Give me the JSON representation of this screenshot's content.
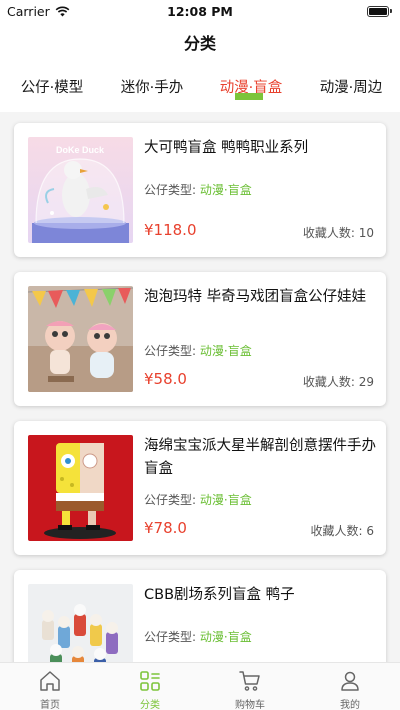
{
  "status_bar": {
    "carrier": "Carrier",
    "time": "12:08 PM"
  },
  "nav": {
    "title": "分类"
  },
  "tabs": [
    {
      "label": "公仔·模型"
    },
    {
      "label": "迷你·手办"
    },
    {
      "label": "动漫·盲盒",
      "active": true
    },
    {
      "label": "动漫·周边"
    }
  ],
  "products": [
    {
      "title": "大可鸭盲盒 鸭鸭职业系列",
      "type_label": "公仔类型:",
      "type_value": "动漫·盲盒",
      "price": "¥118.0",
      "fav_label": "收藏人数:",
      "fav_count": "10",
      "image_text": "DoKe Duck"
    },
    {
      "title": "泡泡玛特 毕奇马戏团盲盒公仔娃娃",
      "type_label": "公仔类型:",
      "type_value": "动漫·盲盒",
      "price": "¥58.0",
      "fav_label": "收藏人数:",
      "fav_count": "29"
    },
    {
      "title": "海绵宝宝派大星半解剖创意摆件手办盲盒",
      "type_label": "公仔类型:",
      "type_value": "动漫·盲盒",
      "price": "¥78.0",
      "fav_label": "收藏人数:",
      "fav_count": "6"
    },
    {
      "title": "CBB剧场系列盲盒 鸭子",
      "type_label": "公仔类型:",
      "type_value": "动漫·盲盒"
    }
  ],
  "bottom_tabs": [
    {
      "label": "首页",
      "icon": "home-icon"
    },
    {
      "label": "分类",
      "icon": "category-icon",
      "active": true
    },
    {
      "label": "购物车",
      "icon": "cart-icon"
    },
    {
      "label": "我的",
      "icon": "profile-icon"
    }
  ],
  "colors": {
    "accent_red": "#e8412e",
    "accent_green": "#7cc43a",
    "type_green": "#6bbf35"
  }
}
